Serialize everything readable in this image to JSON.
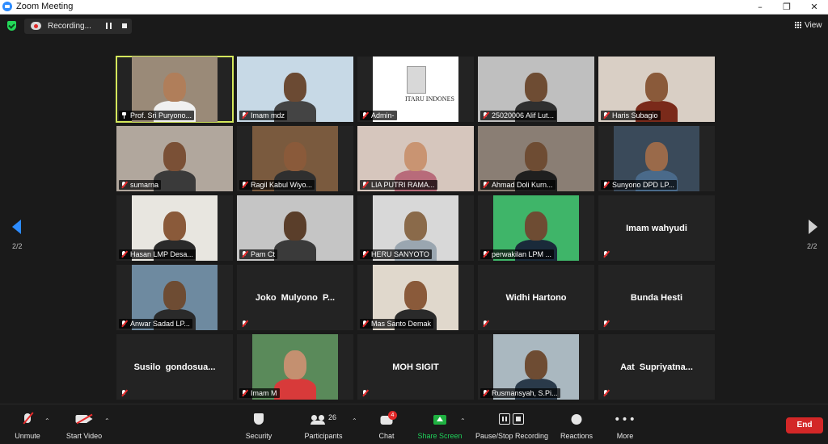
{
  "window": {
    "title": "Zoom Meeting"
  },
  "recording": {
    "label": "Recording..."
  },
  "view": {
    "label": "View"
  },
  "page_indicator": {
    "left": "2/2",
    "right": "2/2"
  },
  "participants_grid": [
    {
      "name": "Prof. Sri Puryono...",
      "video": true,
      "active": true,
      "pinned": true,
      "bg": "#9a8a78",
      "skin": "#b07e5a",
      "shirt": "#f0f0f0"
    },
    {
      "name": "Imam mdz",
      "video": true,
      "bg": "#c7d9e6",
      "skin": "#6b4a33",
      "shirt": "#444444"
    },
    {
      "name": "Admin-",
      "video": true,
      "bg": "#ffffff",
      "skin": "#cccccc",
      "shirt": "#cccccc",
      "logo_text": "ITARU INDONES"
    },
    {
      "name": "25020006 Alif Lut...",
      "video": true,
      "bg": "#bfbfbf",
      "skin": "#6e4c33",
      "shirt": "#2f2f2f"
    },
    {
      "name": "Haris Subagio",
      "video": true,
      "bg": "#d9cfc5",
      "skin": "#8a5a3a",
      "shirt": "#7a2a1a"
    },
    {
      "name": "sumarna",
      "video": true,
      "bg": "#b1a79d",
      "skin": "#7a5036",
      "shirt": "#3a3a3a"
    },
    {
      "name": "Ragil Kabul Wiyo...",
      "video": true,
      "bg": "#7a5a3e",
      "skin": "#8a5a3a",
      "shirt": "#2f2f2f"
    },
    {
      "name": "LIA PUTRI RAMA...",
      "video": true,
      "bg": "#d6c6bd",
      "skin": "#c99472",
      "shirt": "#b86b7a"
    },
    {
      "name": "Ahmad Doli Kurn...",
      "video": true,
      "bg": "#8a7e74",
      "skin": "#6e4c33",
      "shirt": "#1f1f1f"
    },
    {
      "name": "Sunyono DPD LP...",
      "video": true,
      "bg": "#3a4a5a",
      "skin": "#9a6a4a",
      "shirt": "#4a6a8a"
    },
    {
      "name": "Hasan LMP Desa...",
      "video": true,
      "bg": "#e8e6e0",
      "skin": "#8a5a3a",
      "shirt": "#2a2a2a"
    },
    {
      "name": "Pam Ct",
      "video": true,
      "bg": "#c5c5c5",
      "skin": "#5a3e2a",
      "shirt": "#3a3a3a"
    },
    {
      "name": "HERU SANYOTO",
      "video": true,
      "bg": "#d8d8d8",
      "skin": "#8a6a4a",
      "shirt": "#9aa6b0"
    },
    {
      "name": "perwakilan LPM ...",
      "video": true,
      "bg": "#3fb569",
      "skin": "#6e4c33",
      "shirt": "#1a2a3a"
    },
    {
      "name": "Imam wahyudi",
      "video": false
    },
    {
      "name": "Anwar Sadad LP...",
      "video": true,
      "bg": "#6e8aa0",
      "skin": "#6e4c33",
      "shirt": "#2a2a2a"
    },
    {
      "name": "Joko  Mulyono  P...",
      "video": false
    },
    {
      "name": "Mas Santo Demak",
      "video": true,
      "bg": "#e0d8cc",
      "skin": "#8a5a3a",
      "shirt": "#2a2a2a"
    },
    {
      "name": "Widhi Hartono",
      "video": false
    },
    {
      "name": "Bunda Hesti",
      "video": false
    },
    {
      "name": "Susilo  gondosua...",
      "video": false
    },
    {
      "name": "Imam M",
      "video": true,
      "bg": "#5a8a5a",
      "skin": "#c49070",
      "shirt": "#d83a3a"
    },
    {
      "name": "MOH SIGIT",
      "video": false
    },
    {
      "name": "Rusmansyah, S.Pi...",
      "video": true,
      "bg": "#aab8c0",
      "skin": "#6e4c33",
      "shirt": "#2a3a4a"
    },
    {
      "name": "Aat  Supriyatna...",
      "video": false
    }
  ],
  "toolbar": {
    "unmute": "Unmute",
    "start_video": "Start Video",
    "security": "Security",
    "participants": "Participants",
    "participants_count": "26",
    "chat": "Chat",
    "chat_badge": "4",
    "share_screen": "Share Screen",
    "pause_stop_recording": "Pause/Stop Recording",
    "reactions": "Reactions",
    "more": "More",
    "end": "End"
  },
  "colors": {
    "accent": "#2d8cff",
    "share_green": "#1fb141",
    "end_red": "#d32727",
    "active_speaker": "#d4e85c",
    "muted_red": "#e82b2b"
  }
}
